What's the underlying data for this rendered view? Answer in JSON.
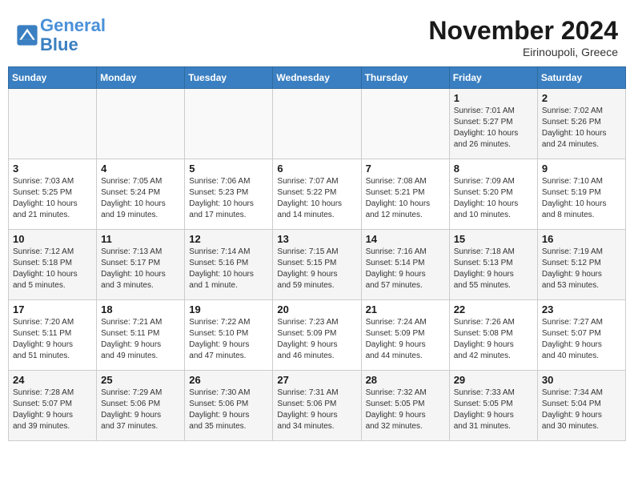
{
  "header": {
    "logo_line1": "General",
    "logo_line2": "Blue",
    "month": "November 2024",
    "location": "Eirinoupoli, Greece"
  },
  "weekdays": [
    "Sunday",
    "Monday",
    "Tuesday",
    "Wednesday",
    "Thursday",
    "Friday",
    "Saturday"
  ],
  "weeks": [
    [
      {
        "day": "",
        "info": ""
      },
      {
        "day": "",
        "info": ""
      },
      {
        "day": "",
        "info": ""
      },
      {
        "day": "",
        "info": ""
      },
      {
        "day": "",
        "info": ""
      },
      {
        "day": "1",
        "info": "Sunrise: 7:01 AM\nSunset: 5:27 PM\nDaylight: 10 hours\nand 26 minutes."
      },
      {
        "day": "2",
        "info": "Sunrise: 7:02 AM\nSunset: 5:26 PM\nDaylight: 10 hours\nand 24 minutes."
      }
    ],
    [
      {
        "day": "3",
        "info": "Sunrise: 7:03 AM\nSunset: 5:25 PM\nDaylight: 10 hours\nand 21 minutes."
      },
      {
        "day": "4",
        "info": "Sunrise: 7:05 AM\nSunset: 5:24 PM\nDaylight: 10 hours\nand 19 minutes."
      },
      {
        "day": "5",
        "info": "Sunrise: 7:06 AM\nSunset: 5:23 PM\nDaylight: 10 hours\nand 17 minutes."
      },
      {
        "day": "6",
        "info": "Sunrise: 7:07 AM\nSunset: 5:22 PM\nDaylight: 10 hours\nand 14 minutes."
      },
      {
        "day": "7",
        "info": "Sunrise: 7:08 AM\nSunset: 5:21 PM\nDaylight: 10 hours\nand 12 minutes."
      },
      {
        "day": "8",
        "info": "Sunrise: 7:09 AM\nSunset: 5:20 PM\nDaylight: 10 hours\nand 10 minutes."
      },
      {
        "day": "9",
        "info": "Sunrise: 7:10 AM\nSunset: 5:19 PM\nDaylight: 10 hours\nand 8 minutes."
      }
    ],
    [
      {
        "day": "10",
        "info": "Sunrise: 7:12 AM\nSunset: 5:18 PM\nDaylight: 10 hours\nand 5 minutes."
      },
      {
        "day": "11",
        "info": "Sunrise: 7:13 AM\nSunset: 5:17 PM\nDaylight: 10 hours\nand 3 minutes."
      },
      {
        "day": "12",
        "info": "Sunrise: 7:14 AM\nSunset: 5:16 PM\nDaylight: 10 hours\nand 1 minute."
      },
      {
        "day": "13",
        "info": "Sunrise: 7:15 AM\nSunset: 5:15 PM\nDaylight: 9 hours\nand 59 minutes."
      },
      {
        "day": "14",
        "info": "Sunrise: 7:16 AM\nSunset: 5:14 PM\nDaylight: 9 hours\nand 57 minutes."
      },
      {
        "day": "15",
        "info": "Sunrise: 7:18 AM\nSunset: 5:13 PM\nDaylight: 9 hours\nand 55 minutes."
      },
      {
        "day": "16",
        "info": "Sunrise: 7:19 AM\nSunset: 5:12 PM\nDaylight: 9 hours\nand 53 minutes."
      }
    ],
    [
      {
        "day": "17",
        "info": "Sunrise: 7:20 AM\nSunset: 5:11 PM\nDaylight: 9 hours\nand 51 minutes."
      },
      {
        "day": "18",
        "info": "Sunrise: 7:21 AM\nSunset: 5:11 PM\nDaylight: 9 hours\nand 49 minutes."
      },
      {
        "day": "19",
        "info": "Sunrise: 7:22 AM\nSunset: 5:10 PM\nDaylight: 9 hours\nand 47 minutes."
      },
      {
        "day": "20",
        "info": "Sunrise: 7:23 AM\nSunset: 5:09 PM\nDaylight: 9 hours\nand 46 minutes."
      },
      {
        "day": "21",
        "info": "Sunrise: 7:24 AM\nSunset: 5:09 PM\nDaylight: 9 hours\nand 44 minutes."
      },
      {
        "day": "22",
        "info": "Sunrise: 7:26 AM\nSunset: 5:08 PM\nDaylight: 9 hours\nand 42 minutes."
      },
      {
        "day": "23",
        "info": "Sunrise: 7:27 AM\nSunset: 5:07 PM\nDaylight: 9 hours\nand 40 minutes."
      }
    ],
    [
      {
        "day": "24",
        "info": "Sunrise: 7:28 AM\nSunset: 5:07 PM\nDaylight: 9 hours\nand 39 minutes."
      },
      {
        "day": "25",
        "info": "Sunrise: 7:29 AM\nSunset: 5:06 PM\nDaylight: 9 hours\nand 37 minutes."
      },
      {
        "day": "26",
        "info": "Sunrise: 7:30 AM\nSunset: 5:06 PM\nDaylight: 9 hours\nand 35 minutes."
      },
      {
        "day": "27",
        "info": "Sunrise: 7:31 AM\nSunset: 5:06 PM\nDaylight: 9 hours\nand 34 minutes."
      },
      {
        "day": "28",
        "info": "Sunrise: 7:32 AM\nSunset: 5:05 PM\nDaylight: 9 hours\nand 32 minutes."
      },
      {
        "day": "29",
        "info": "Sunrise: 7:33 AM\nSunset: 5:05 PM\nDaylight: 9 hours\nand 31 minutes."
      },
      {
        "day": "30",
        "info": "Sunrise: 7:34 AM\nSunset: 5:04 PM\nDaylight: 9 hours\nand 30 minutes."
      }
    ]
  ]
}
